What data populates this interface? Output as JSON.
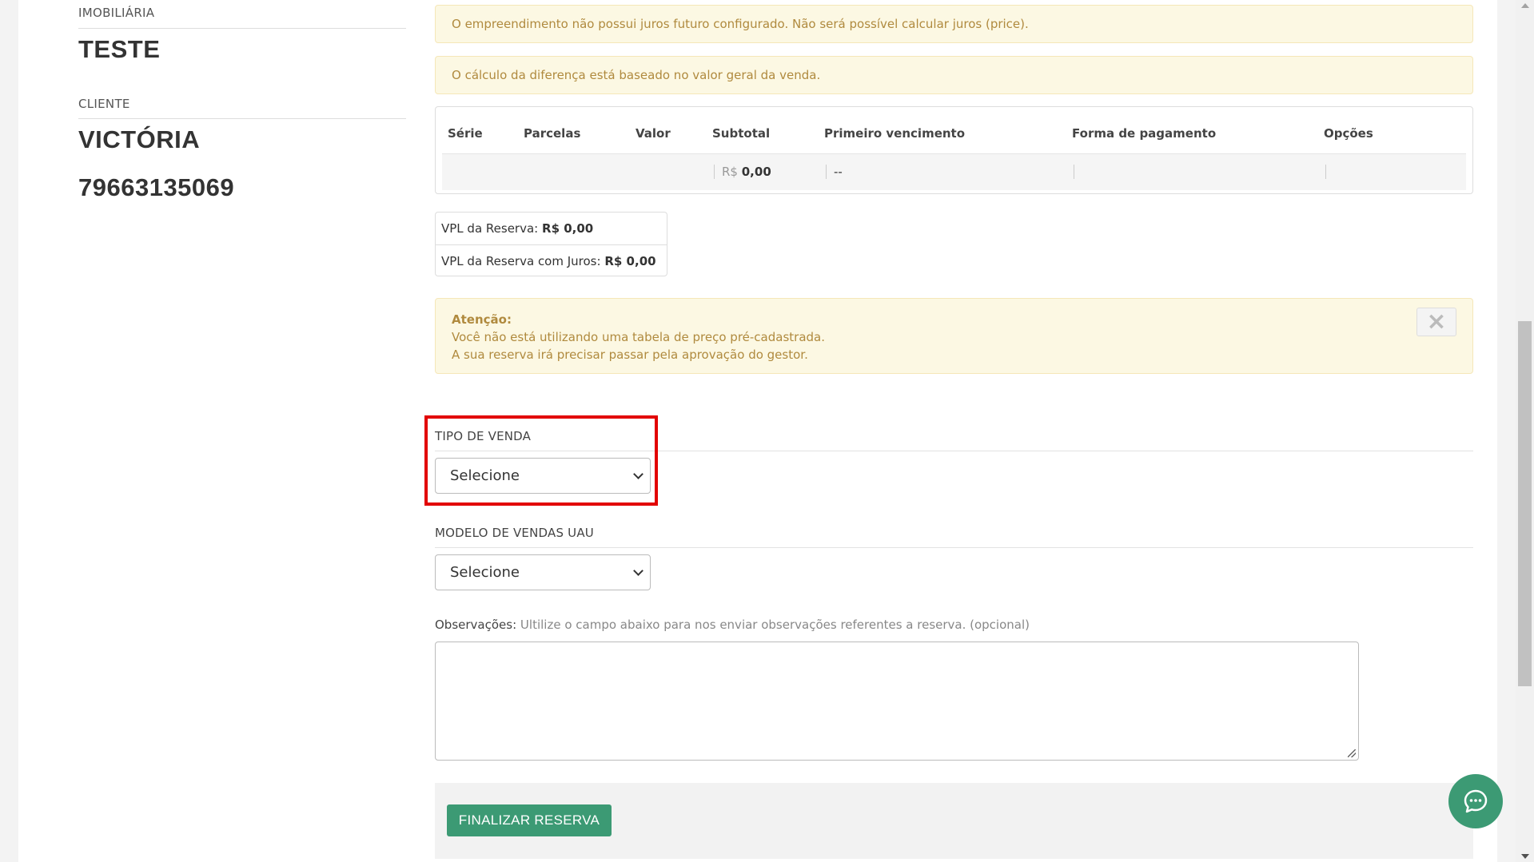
{
  "left": {
    "imobiliaria_label": "IMOBILIÁRIA",
    "imobiliaria_value": "TESTE",
    "cliente_label": "CLIENTE",
    "cliente_name": "VICTÓRIA",
    "cliente_doc": "79663135069"
  },
  "alerts": {
    "juros": "O empreendimento não possui juros futuro configurado. Não será possível calcular juros (price).",
    "diferenca": "O cálculo da diferença está baseado no valor geral da venda."
  },
  "table": {
    "headers": [
      "Série",
      "Parcelas",
      "Valor",
      "Subtotal",
      "Primeiro vencimento",
      "Forma de pagamento",
      "Opções"
    ],
    "row": {
      "serie": "",
      "parcelas": "",
      "valor": "",
      "subtotal_currency": "R$",
      "subtotal_value": "0,00",
      "primeiro_vencimento": "--",
      "forma_pagamento": "",
      "opcoes": ""
    }
  },
  "vpl": {
    "reserva_label": "VPL da Reserva:",
    "reserva_value": "R$ 0,00",
    "juros_label": "VPL da Reserva com Juros:",
    "juros_value": "R$ 0,00"
  },
  "attention": {
    "title": "Atenção:",
    "line1": "Você não está utilizando uma tabela de preço pré-cadastrada.",
    "line2": "A sua reserva irá precisar passar pela aprovação do gestor.",
    "close_symbol": "×"
  },
  "tipo_venda": {
    "label": "TIPO DE VENDA",
    "selected": "Selecione"
  },
  "modelo_vendas": {
    "label": "MODELO DE VENDAS UAU",
    "selected": "Selecione"
  },
  "observacoes": {
    "label": "Observações:",
    "hint": "Ultilize o campo abaixo para nos enviar observações referentes a reserva. (opcional)",
    "value": ""
  },
  "actions": {
    "finalizar": "FINALIZAR RESERVA"
  },
  "colors": {
    "accent": "#3c9a74",
    "warning_bg": "#fcf8e3",
    "warning_text": "#b08a3e",
    "highlight": "#e20000"
  },
  "icons": {
    "chat": "chat-bubble-icon",
    "close": "close-icon",
    "select_arrow": "chevron-down-icon"
  }
}
